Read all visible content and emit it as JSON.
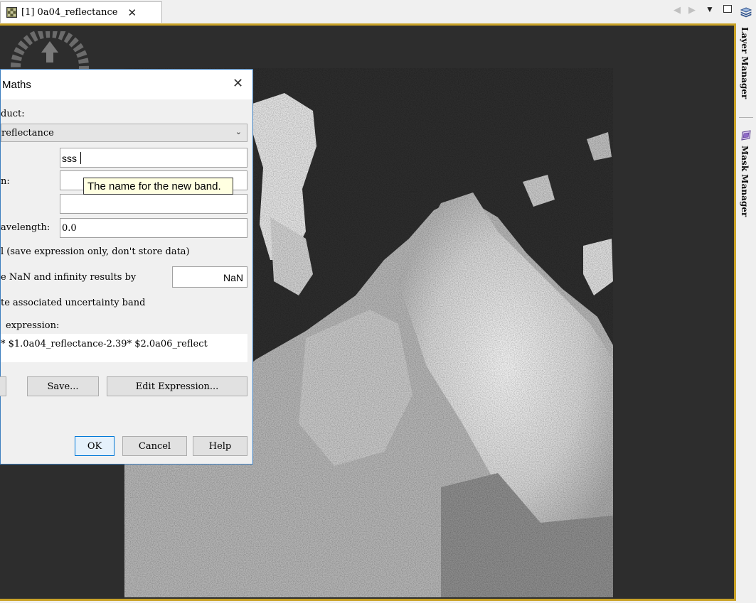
{
  "tab": {
    "icon": "raster-grid-icon",
    "title": "[1] 0a04_reflectance",
    "close_glyph": "✕"
  },
  "tab_controls": {
    "left_glyph": "◀",
    "right_glyph": "▶",
    "menu_glyph": "▼"
  },
  "side_panel": {
    "items": [
      {
        "icon": "layers-icon",
        "label": "Layer Manager"
      },
      {
        "icon": "mask-icon",
        "label": "Mask Manager"
      }
    ]
  },
  "dialog": {
    "title": "Maths",
    "close_glyph": "✕",
    "product_label": "duct:",
    "product_value": "reflectance",
    "name_value": "sss",
    "description_label": "n:",
    "description_value": "",
    "unit_value": "",
    "wavelength_label": "avelength:",
    "wavelength_value": "0.0",
    "virtual_label": "l (save expression only, don't store data)",
    "replace_nan_label": "e NaN and infinity results by",
    "replace_nan_value": "NaN",
    "uncertainty_label": "te associated uncertainty band",
    "expression_label": "expression:",
    "expression_value": "* $1.0a04_reflectance-2.39* $2.0a06_reflect",
    "save_button": "Save...",
    "edit_expression_button": "Edit Expression...",
    "ok_button": "OK",
    "cancel_button": "Cancel",
    "help_button": "Help"
  },
  "tooltip": {
    "text": "The name for the new band."
  },
  "colors": {
    "view_background": "#2d2d2d",
    "view_border": "#c9a227",
    "dialog_border": "#3d7ebf",
    "tooltip_background": "#ffffe1"
  }
}
